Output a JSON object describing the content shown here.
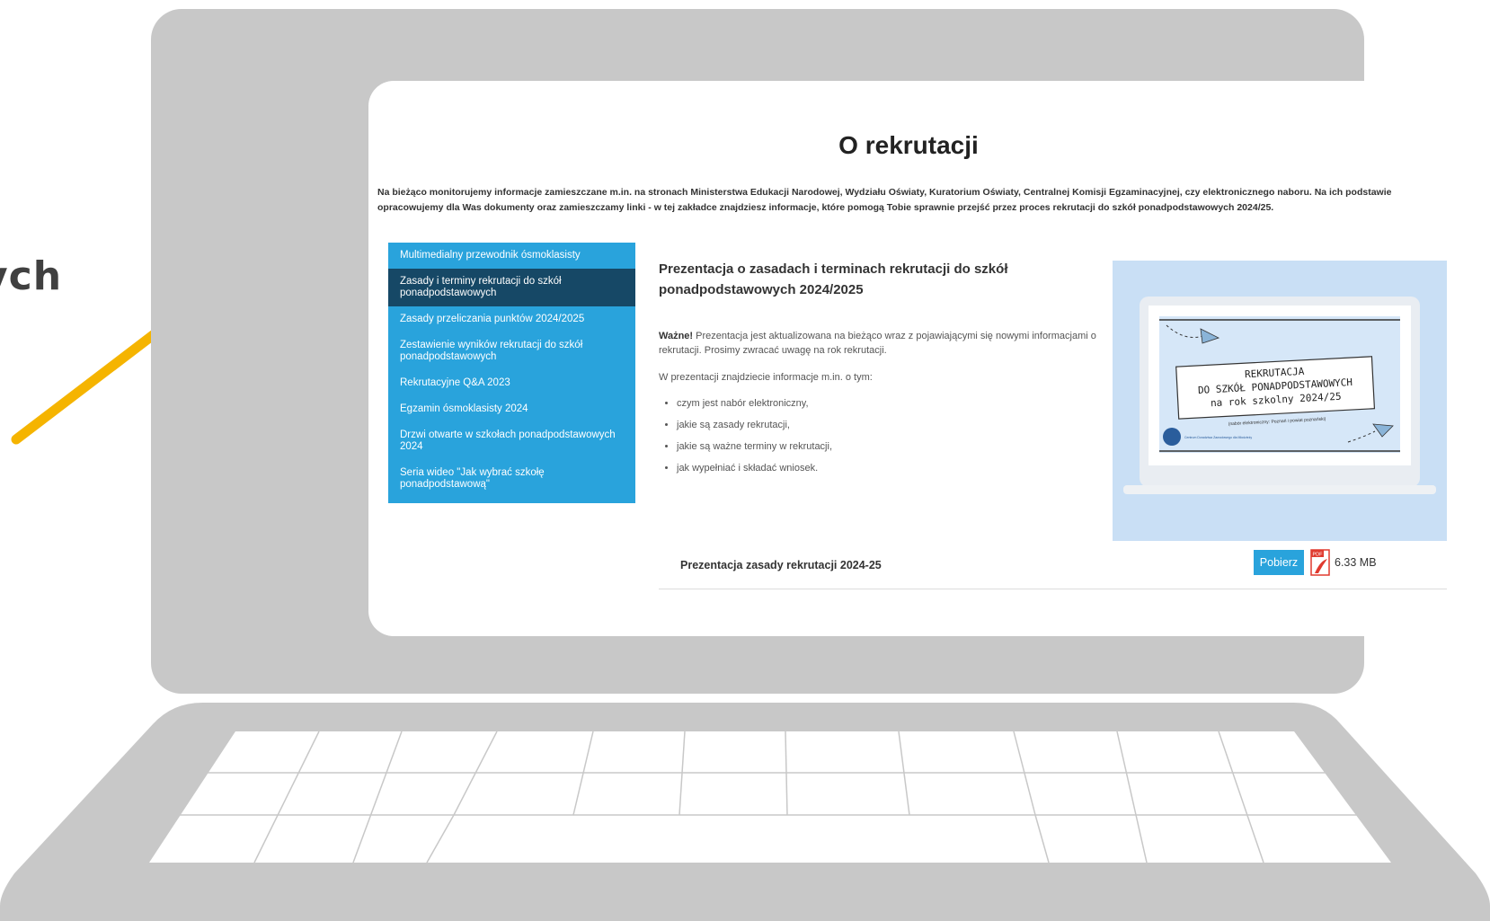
{
  "side_text": "ych",
  "page": {
    "title": "O rekrutacji",
    "intro": "Na bieżąco monitorujemy informacje zamieszczane m.in. na stronach Ministerstwa Edukacji Narodowej, Wydziału Oświaty, Kuratorium Oświaty, Centralnej Komisji Egzaminacyjnej, czy elektronicznego naboru. Na ich podstawie opracowujemy dla Was dokumenty oraz zamieszczamy linki - w tej zakładce znajdziesz informacje, które pomogą Tobie sprawnie przejść przez proces rekrutacji do szkół ponadpodstawowych 2024/25."
  },
  "sidebar": {
    "items": [
      {
        "label": "Multimedialny przewodnik ósmoklasisty"
      },
      {
        "label": "Zasady i terminy rekrutacji do szkół ponadpodstawowych"
      },
      {
        "label": "Zasady przeliczania punktów 2024/2025"
      },
      {
        "label": "Zestawienie wyników rekrutacji do szkół ponadpodstawowych"
      },
      {
        "label": "Rekrutacyjne Q&A 2023"
      },
      {
        "label": "Egzamin ósmoklasisty 2024"
      },
      {
        "label": "Drzwi otwarte w szkołach ponadpodstawowych 2024"
      },
      {
        "label": "Seria wideo \"Jak wybrać szkołę ponadpodstawową\""
      }
    ],
    "active_index": 1
  },
  "content": {
    "heading": "Prezentacja o zasadach i terminach rekrutacji do szkół ponadpodstawowych 2024/2025",
    "note_strong": "Ważne!",
    "note_text": " Prezentacja jest aktualizowana na bieżąco wraz z pojawiającymi się nowymi informacjami o rekrutacji. Prosimy zwracać uwagę na rok rekrutacji.",
    "list_intro": "W prezentacji znajdziecie informacje m.in. o tym:",
    "bullets": [
      "czym jest nabór elektroniczny,",
      "jakie są zasady rekrutacji,",
      "jakie są ważne terminy w rekrutacji,",
      "jak wypełniać i składać wniosek."
    ]
  },
  "preview": {
    "line1": "REKRUTACJA",
    "line2": "DO SZKÓŁ PONADPODSTAWOWYCH",
    "line3": "na rok szkolny 2024/25",
    "caption": "(nabór elektroniczny: Poznań i powiat poznański)",
    "logo_text": "Centrum Doradztwa Zawodowego dla Młodzieży"
  },
  "download": {
    "label": "Prezentacja zasady rekrutacji 2024-25",
    "button": "Pobierz",
    "size": "6.33 MB",
    "pdf_icon_text": "PDF"
  },
  "colors": {
    "sidebar": "#29a3dc",
    "sidebar_active": "#164866",
    "laptop": "#c8c8c8",
    "arrow": "#f5b400"
  }
}
